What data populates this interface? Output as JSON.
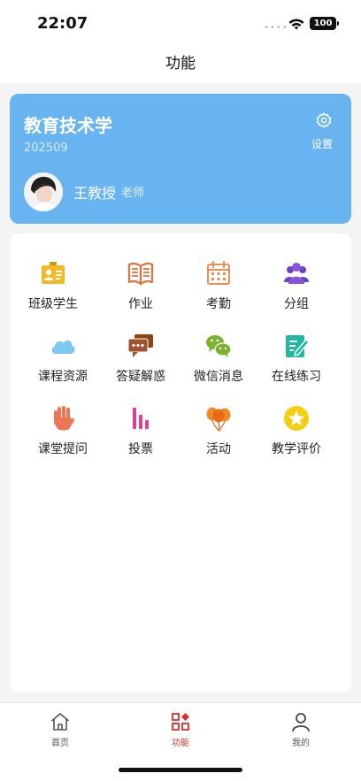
{
  "status_bar": {
    "time": "22:07",
    "battery": "100"
  },
  "navbar": {
    "title": "功能"
  },
  "profile": {
    "course_name": "教育技术学",
    "course_code": "202509",
    "settings_label": "设置",
    "teacher_name": "王教授",
    "teacher_role": "老师"
  },
  "features": [
    {
      "label": "班级学生",
      "icon": "student-card-icon"
    },
    {
      "label": "作业",
      "icon": "book-icon"
    },
    {
      "label": "考勤",
      "icon": "calendar-icon"
    },
    {
      "label": "分组",
      "icon": "group-icon"
    },
    {
      "label": "课程资源",
      "icon": "cloud-icon"
    },
    {
      "label": "答疑解惑",
      "icon": "chat-bubbles-icon"
    },
    {
      "label": "微信消息",
      "icon": "wechat-icon"
    },
    {
      "label": "在线练习",
      "icon": "edit-note-icon"
    },
    {
      "label": "课堂提问",
      "icon": "raised-hand-icon"
    },
    {
      "label": "投票",
      "icon": "bar-chart-icon"
    },
    {
      "label": "活动",
      "icon": "balloons-icon"
    },
    {
      "label": "教学评价",
      "icon": "star-badge-icon"
    }
  ],
  "tabbar": {
    "items": [
      {
        "label": "首页",
        "icon": "home-icon"
      },
      {
        "label": "功能",
        "icon": "apps-icon"
      },
      {
        "label": "我的",
        "icon": "user-icon"
      }
    ]
  },
  "colors": {
    "card_background": "#68b4f1",
    "tab_active": "#d9302c",
    "tab_inactive": "#555555"
  }
}
